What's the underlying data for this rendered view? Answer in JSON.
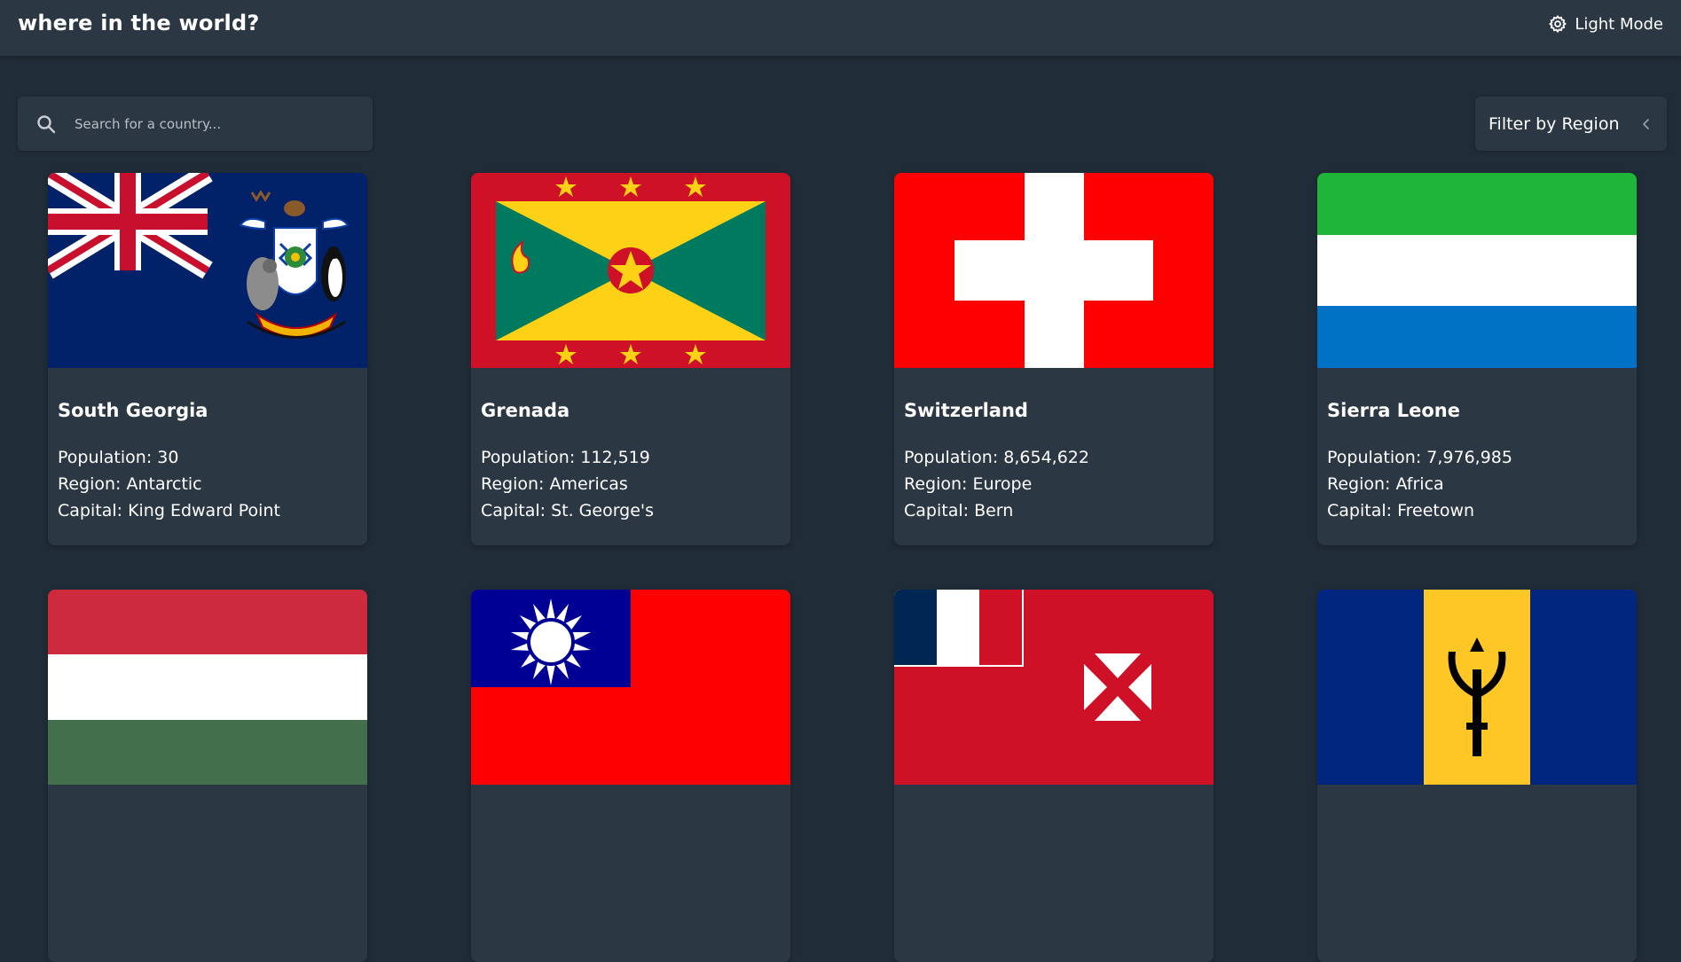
{
  "header": {
    "title": "where in the world?",
    "mode_label": "Light Mode"
  },
  "search": {
    "placeholder": "Search for a country..."
  },
  "filter": {
    "label": "Filter by Region"
  },
  "labels": {
    "population": "Population: ",
    "region": "Region: ",
    "capital": "Capital: "
  },
  "countries": [
    {
      "name": "South Georgia",
      "population": "30",
      "region": "Antarctic",
      "capital": "King Edward Point",
      "flag": "south-georgia-flag"
    },
    {
      "name": "Grenada",
      "population": "112,519",
      "region": "Americas",
      "capital": "St. George's",
      "flag": "grenada-flag"
    },
    {
      "name": "Switzerland",
      "population": "8,654,622",
      "region": "Europe",
      "capital": "Bern",
      "flag": "switzerland-flag"
    },
    {
      "name": "Sierra Leone",
      "population": "7,976,985",
      "region": "Africa",
      "capital": "Freetown",
      "flag": "sierra-leone-flag"
    },
    {
      "flag": "hungary-flag"
    },
    {
      "flag": "taiwan-flag"
    },
    {
      "flag": "wallis-and-futuna-flag"
    },
    {
      "flag": "barbados-flag"
    }
  ],
  "colors": {
    "background": "#202c37",
    "element": "#2b3743",
    "text": "#ffffff"
  }
}
